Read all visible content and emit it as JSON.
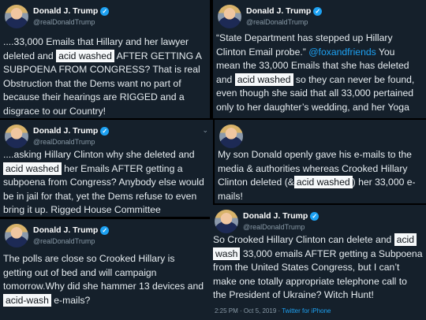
{
  "author": {
    "name": "Donald J. Trump",
    "handle": "@realDonaldTrump"
  },
  "icons": {
    "verified": "verified-badge-icon",
    "more": "chevron-down-icon"
  },
  "tweet1": {
    "l1": "....33,000 Emails that Hillary and her lawyer",
    "l2a": "deleted and ",
    "l2hl": "acid washed",
    "l2b": " AFTER GETTING A",
    "l3": "SUBPOENA FROM CONGRESS? That is real",
    "l4": "Obstruction that the Dems want no part of",
    "l5": "because their hearings are RIGGED and a",
    "l6": "disgrace to our Country!"
  },
  "tweet2": {
    "l1": "“State Department has stepped up Hillary",
    "l2a": "Clinton Email probe.” ",
    "l2link": "@foxandfriends",
    "l2b": "  You",
    "l3": "mean the 33,000 Emails that she has deleted",
    "l4a": "and ",
    "l4hl": "acid washed",
    "l4b": " so they can never be found,",
    "l5": "even though she said that all 33,000 pertained",
    "l6": "only to her daughter’s wedding, and her Yoga"
  },
  "tweet3": {
    "l1": "....asking Hillary Clinton why she deleted and",
    "l2hl": "acid washed",
    "l2b": " her Emails AFTER getting a",
    "l3": "subpoena from Congress? Anybody else would",
    "l4": "be in jail for that, yet the Dems refuse to even",
    "l5": "bring it up. Rigged House Committee"
  },
  "tweet4": {
    "l1": "My son Donald openly gave his e-mails to the",
    "l2": "media & authorities whereas Crooked Hillary",
    "l3a": "Clinton deleted (&",
    "l3hl": "acid washed",
    "l3b": ") her 33,000 e-",
    "l4": "mails!"
  },
  "tweet5": {
    "l1": "The polls are close so Crooked Hillary is",
    "l2": "getting out of bed and will campaign",
    "l3": "tomorrow.Why did she hammer 13 devices and",
    "l4hl": "acid-wash",
    "l4b": " e-mails?"
  },
  "tweet6": {
    "l1a": "So Crooked Hillary Clinton can delete and ",
    "l1hl": "acid",
    "l2hl": "wash",
    "l2b": " 33,000 emails AFTER getting a Subpoena",
    "l3": "from the United States Congress, but I can’t",
    "l4": "make one totally appropriate telephone call to",
    "l5": "the President of Ukraine? Witch Hunt!",
    "meta_time": "2:25 PM · Oct 5, 2019 · ",
    "meta_source": "Twitter for iPhone"
  }
}
